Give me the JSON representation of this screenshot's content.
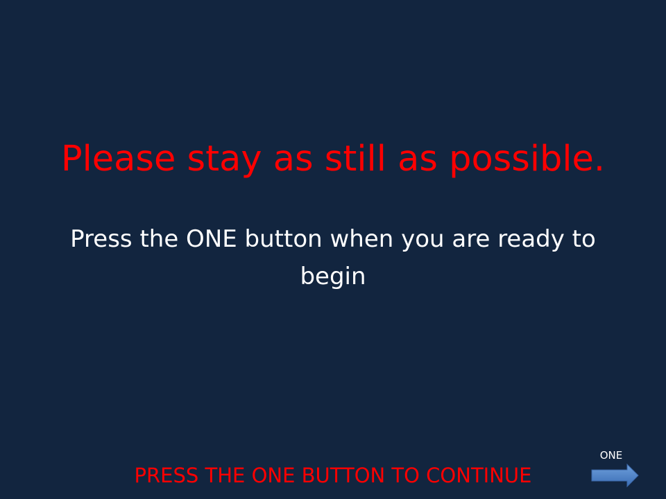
{
  "slide": {
    "headline": "Please stay as still as possible.",
    "instruction": "Press the ONE button when you are ready to begin",
    "continue_prompt": "PRESS THE ONE BUTTON TO CONTINUE"
  },
  "next_button": {
    "label": "ONE",
    "icon": "right-arrow-icon"
  },
  "colors": {
    "background": "#12253f",
    "headline": "#ff0000",
    "instruction": "#ffffff",
    "continue_prompt": "#ff0000",
    "arrow": "#4f81bd"
  }
}
